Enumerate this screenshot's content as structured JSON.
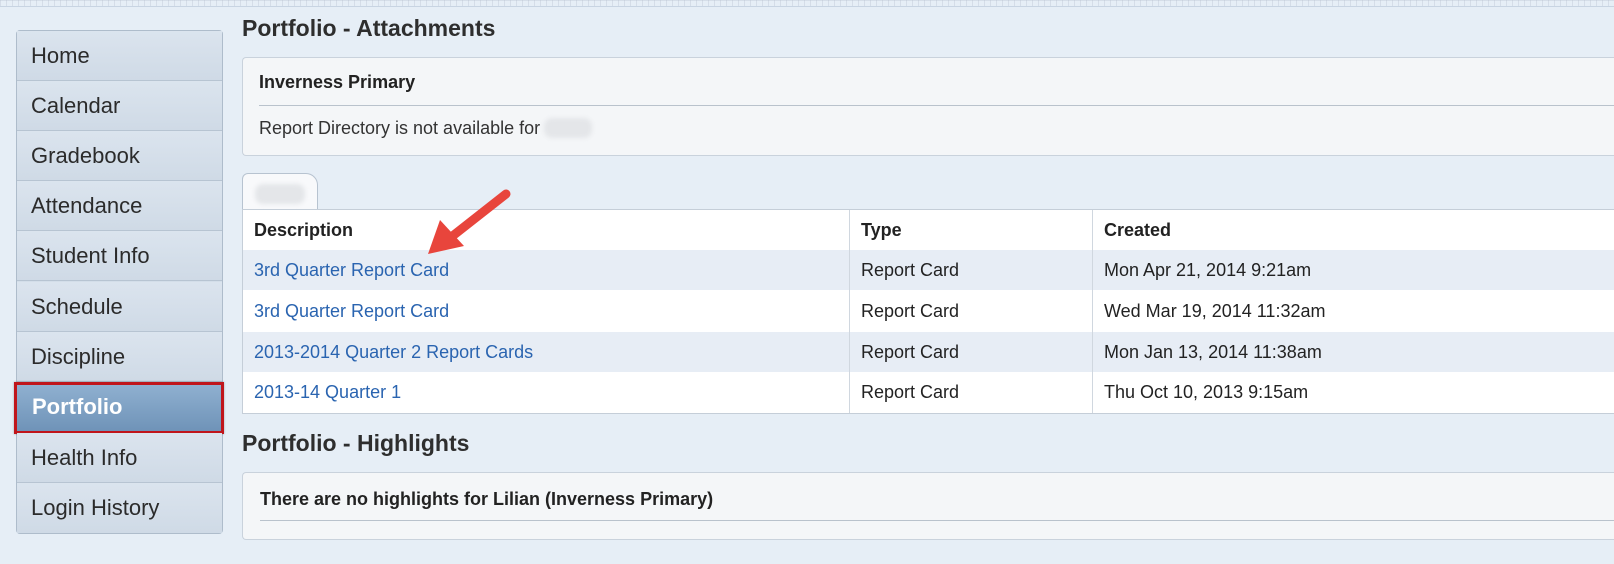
{
  "sidebar": {
    "items": [
      {
        "label": "Home"
      },
      {
        "label": "Calendar"
      },
      {
        "label": "Gradebook"
      },
      {
        "label": "Attendance"
      },
      {
        "label": "Student Info"
      },
      {
        "label": "Schedule"
      },
      {
        "label": "Discipline"
      },
      {
        "label": "Portfolio"
      },
      {
        "label": "Health Info"
      },
      {
        "label": "Login History"
      }
    ],
    "active": "Portfolio"
  },
  "attachments": {
    "title": "Portfolio - Attachments",
    "school": "Inverness Primary",
    "note": "Report Directory is not available for",
    "table": {
      "headers": [
        "Description",
        "Type",
        "Created"
      ],
      "rows": [
        {
          "description": "3rd Quarter Report Card",
          "type": "Report Card",
          "created": "Mon Apr 21, 2014 9:21am"
        },
        {
          "description": "3rd Quarter Report Card",
          "type": "Report Card",
          "created": "Wed Mar 19, 2014 11:32am"
        },
        {
          "description": "2013-2014 Quarter 2 Report Cards",
          "type": "Report Card",
          "created": "Mon Jan 13, 2014 11:38am"
        },
        {
          "description": "2013-14 Quarter 1",
          "type": "Report Card",
          "created": "Thu Oct 10, 2013 9:15am"
        }
      ]
    }
  },
  "highlights": {
    "title": "Portfolio - Highlights",
    "message": "There are no highlights for Lilian (Inverness Primary)"
  },
  "colors": {
    "active_border": "#c0151b",
    "link": "#2a64b0",
    "arrow": "#e8453c"
  }
}
